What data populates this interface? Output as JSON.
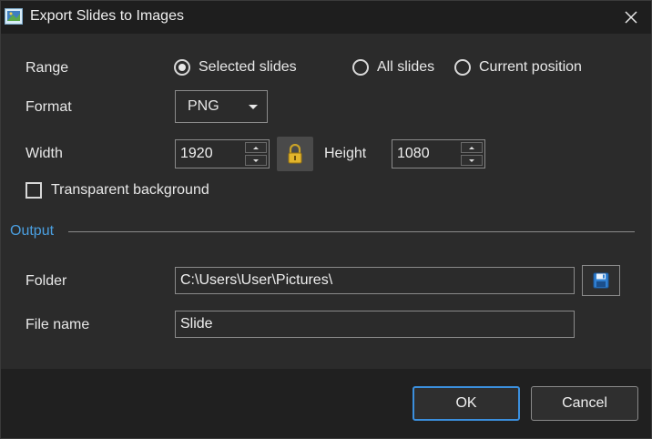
{
  "window": {
    "title": "Export Slides to Images"
  },
  "range": {
    "label": "Range",
    "options": [
      {
        "label": "Selected slides",
        "selected": true
      },
      {
        "label": "All slides",
        "selected": false
      },
      {
        "label": "Current position",
        "selected": false
      }
    ]
  },
  "format": {
    "label": "Format",
    "value": "PNG"
  },
  "size": {
    "width_label": "Width",
    "width_value": "1920",
    "height_label": "Height",
    "height_value": "1080"
  },
  "transparent": {
    "label": "Transparent background",
    "checked": false
  },
  "output": {
    "section_label": "Output",
    "folder_label": "Folder",
    "folder_value": "C:\\Users\\User\\Pictures\\",
    "filename_label": "File name",
    "filename_value": "Slide"
  },
  "buttons": {
    "ok": "OK",
    "cancel": "Cancel"
  },
  "colors": {
    "accent": "#3b8fdd",
    "section": "#4a9fe0"
  }
}
